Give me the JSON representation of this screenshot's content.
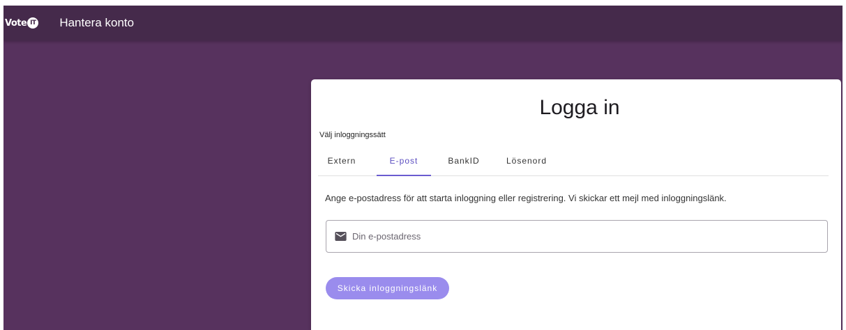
{
  "header": {
    "logo_text": "Vote",
    "logo_badge": "IT",
    "title": "Hantera konto"
  },
  "login": {
    "title": "Logga in",
    "chooser_label": "Välj inloggningssätt",
    "tabs": [
      {
        "label": "Extern",
        "active": false
      },
      {
        "label": "E-post",
        "active": true
      },
      {
        "label": "BankID",
        "active": false
      },
      {
        "label": "Lösenord",
        "active": false
      }
    ],
    "info_text": "Ange e-postadress för att starta inloggning eller registrering. Vi skickar ett mejl med inloggningslänk.",
    "email_placeholder": "Din e-postadress",
    "email_value": "",
    "submit_label": "Skicka inloggningslänk",
    "submit_enabled": false
  },
  "colors": {
    "toolbar": "#452a4b",
    "background": "#57325e",
    "accent": "#6a5cd0",
    "button_disabled": "#9a8ced"
  },
  "icons": {
    "email_field": "mail-icon"
  }
}
